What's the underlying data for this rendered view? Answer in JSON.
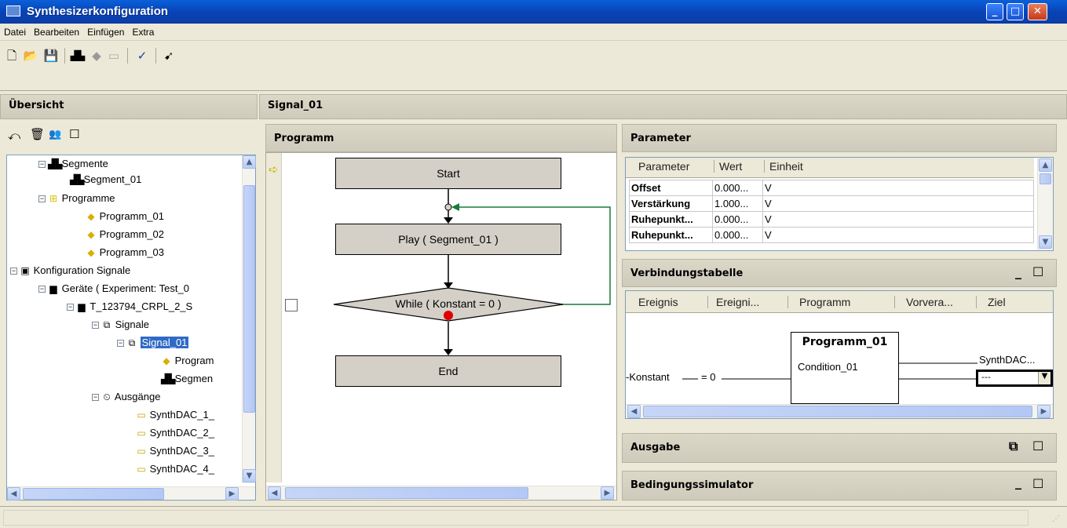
{
  "window": {
    "title": "Synthesizerkonfiguration"
  },
  "menu": [
    "Datei",
    "Bearbeiten",
    "Einfügen",
    "Extra"
  ],
  "toolbar": {
    "icons": [
      "new-icon",
      "open-icon",
      "save-icon",
      "segment-icon",
      "diamond-icon",
      "signal-icon",
      "check-icon",
      "export-icon"
    ]
  },
  "overview": {
    "title": "Übersicht"
  },
  "tree": {
    "segmente": "Segmente",
    "segment_01": "Segment_01",
    "programme": "Programme",
    "programm_01": "Programm_01",
    "programm_02": "Programm_02",
    "programm_03": "Programm_03",
    "konfig": "Konfiguration Signale",
    "geraete": "Geräte ( Experiment: Test_0",
    "device": "T_123794_CRPL_2_S",
    "signale": "Signale",
    "signal_01": "Signal_01",
    "child_prog": "Program",
    "child_seg": "Segmen",
    "ausgaenge": "Ausgänge",
    "dac1": "SynthDAC_1_",
    "dac2": "SynthDAC_2_",
    "dac3": "SynthDAC_3_",
    "dac4": "SynthDAC_4_"
  },
  "editor": {
    "title": "Signal_01"
  },
  "programm": {
    "title": "Programm",
    "start": "Start",
    "play": "Play ( Segment_01 )",
    "while": "While ( Konstant = 0 )",
    "end": "End"
  },
  "parameter": {
    "title": "Parameter",
    "headers": [
      "Parameter",
      "Wert",
      "Einheit"
    ],
    "rows": [
      [
        "Offset",
        "0.000...",
        "V"
      ],
      [
        "Verstärkung",
        "1.000...",
        "V"
      ],
      [
        "Ruhepunkt...",
        "0.000...",
        "V"
      ],
      [
        "Ruhepunkt...",
        "0.000...",
        "V"
      ]
    ]
  },
  "verbindung": {
    "title": "Verbindungstabelle",
    "headers": [
      "Ereignis",
      "Ereigni...",
      "Programm",
      "Vorvera...",
      "Ziel"
    ],
    "block_title": "Programm_01",
    "block_cond": "Condition_01",
    "left_label": "-Konstant",
    "eq_label": "= 0",
    "target": "SynthDAC...",
    "combo": "---"
  },
  "ausgabe": {
    "title": "Ausgabe"
  },
  "bedingung": {
    "title": "Bedingungssimulator"
  },
  "colors": {
    "accent": "#316ac5",
    "arrow_green": "#1a7a3c",
    "dot_red": "#e00000"
  }
}
